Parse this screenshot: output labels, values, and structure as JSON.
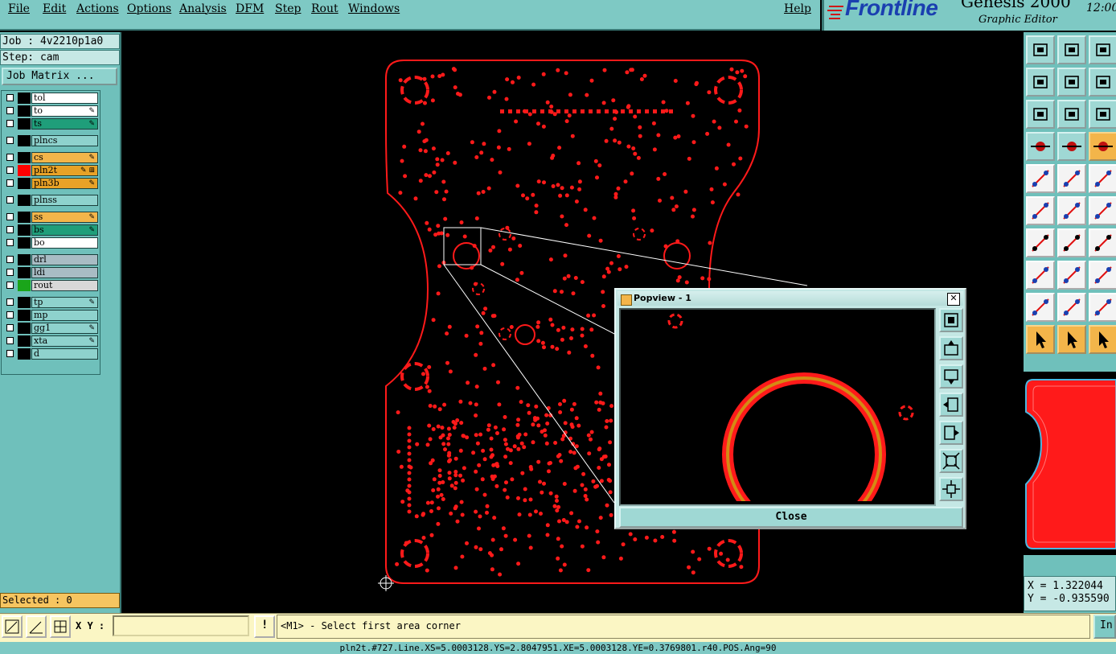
{
  "menu": {
    "items": [
      "File",
      "Edit",
      "Actions",
      "Options",
      "Analysis",
      "DFM",
      "Step",
      "Rout",
      "Windows"
    ],
    "help": "Help"
  },
  "brand": {
    "logo": "Frontline",
    "product": "Genesis 2000",
    "subtitle": "Graphic Editor",
    "clock": "12:00"
  },
  "job": {
    "job_line": "Job : 4v2210p1a0",
    "step_line": "Step: cam",
    "matrix_button": "Job Matrix ..."
  },
  "layers": [
    {
      "name": "tol",
      "bg": "#ffffff",
      "color": "#000000",
      "mark": ""
    },
    {
      "name": "to",
      "bg": "#ffffff",
      "color": "#000000",
      "mark": "✎"
    },
    {
      "name": "ts",
      "bg": "#1f9e7a",
      "color": "#000000",
      "mark": "✎"
    },
    {
      "name": "plncs",
      "bg": "#8ed2cd",
      "color": "#000000",
      "mark": ""
    },
    {
      "name": "cs",
      "bg": "#f3b54a",
      "color": "#000000",
      "mark": "✎"
    },
    {
      "name": "pln2t",
      "bg": "#e8a227",
      "color": "#ff0000",
      "mark": "✎ ⊞"
    },
    {
      "name": "pln3b",
      "bg": "#e8a227",
      "color": "#000000",
      "mark": "✎"
    },
    {
      "name": "plnss",
      "bg": "#8ed2cd",
      "color": "#000000",
      "mark": ""
    },
    {
      "name": "ss",
      "bg": "#f3b54a",
      "color": "#000000",
      "mark": "✎"
    },
    {
      "name": "bs",
      "bg": "#1f9e7a",
      "color": "#000000",
      "mark": "✎"
    },
    {
      "name": "bo",
      "bg": "#ffffff",
      "color": "#000000",
      "mark": ""
    },
    {
      "name": "drl",
      "bg": "#a8bcc4",
      "color": "#000000",
      "mark": ""
    },
    {
      "name": "ldi",
      "bg": "#a8bcc4",
      "color": "#000000",
      "mark": ""
    },
    {
      "name": "rout",
      "bg": "#d8d8d8",
      "color": "#1aa51a",
      "mark": ""
    },
    {
      "name": "tp",
      "bg": "#8ed2cd",
      "color": "#000000",
      "mark": "✎"
    },
    {
      "name": "mp",
      "bg": "#8ed2cd",
      "color": "#000000",
      "mark": ""
    },
    {
      "name": "gg1",
      "bg": "#8ed2cd",
      "color": "#000000",
      "mark": "✎"
    },
    {
      "name": "xta",
      "bg": "#8ed2cd",
      "color": "#000000",
      "mark": "✎"
    },
    {
      "name": "d",
      "bg": "#8ed2cd",
      "color": "#000000",
      "mark": ""
    }
  ],
  "selected_text": "Selected : 0",
  "popview": {
    "title": "Popview - 1",
    "close_label": "Close"
  },
  "coords": {
    "x_line": "X = 1.322044",
    "y_line": "Y = -0.935590"
  },
  "input": {
    "xy_label": "X Y :",
    "value": "",
    "warn_icon": "!"
  },
  "message": "<M1> - Select first area corner",
  "inbutton_label": "In",
  "status_line": "pln2t.#727.Line.XS=5.0003128.YS=2.8047951.XE=5.0003128.YE=0.3769801.r40.POS.Ang=90",
  "colors": {
    "accent": "#7ec9c4",
    "board": "#ff1a1a",
    "selection": "#f3b54a"
  }
}
